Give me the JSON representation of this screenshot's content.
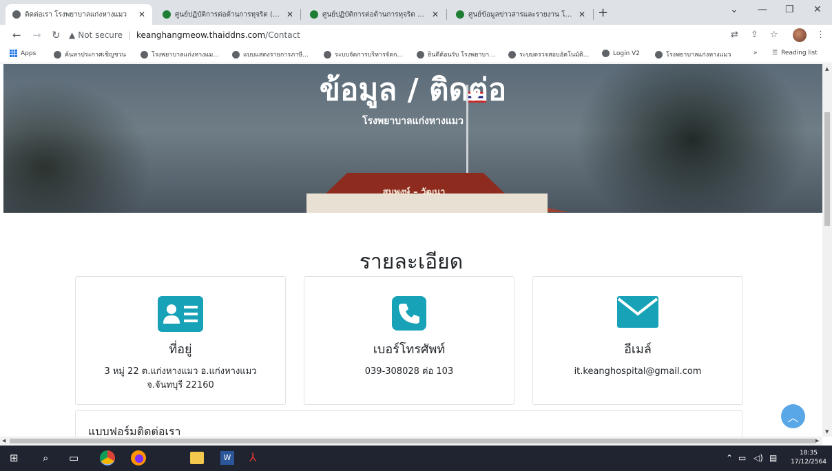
{
  "browser": {
    "tabs": [
      {
        "title": "ติดต่อเรา โรงพยาบาลแก่งหางแมว",
        "active": true,
        "icon": "globe-icon"
      },
      {
        "title": "ศูนย์ปฏิบัติการต่อต้านการทุจริต (สปท.)",
        "active": false,
        "icon": "shield-icon"
      },
      {
        "title": "ศูนย์ปฏิบัติการต่อต้านการทุจริต กระทร",
        "active": false,
        "icon": "shield-icon"
      },
      {
        "title": "ศูนย์ข้อมูลข่าวสารและรายงาน โรงพยา",
        "active": false,
        "icon": "shield-icon"
      }
    ],
    "new_tab": "+",
    "security_label": "Not secure",
    "url_host": "keanghangmeow.thaiddns.com",
    "url_path": "/Contact",
    "bookmarks": [
      "Apps",
      "ค้นหาประกาศเชิญชวน",
      "โรงพยาบาลแก่งหางแม...",
      "แบบแสดงรายการภาษี...",
      "ระบบจัดการบริหารจัดก...",
      "ยินดีต้อนรับ โรงพยาบา...",
      "ระบบตรวจสอบอัตโนมัติ...",
      "Login V2",
      "โรงพยาบาลแก่งหางแมว"
    ],
    "more_bookmarks": "»",
    "reading_list": "Reading list"
  },
  "hero": {
    "title": "ข้อมูล / ติดต่อ",
    "subtitle": "โรงพยาบาลแก่งหางแมว",
    "building_sign": "สมพงษ์ – วัฒนา"
  },
  "details": {
    "section_title": "รายละเอียด",
    "cards": [
      {
        "icon": "id-card-icon",
        "title": "ที่อยู่",
        "text": "3 หมู่ 22 ต.แก่งหางแมว อ.แก่งหางแมว จ.จันทบุรี 22160"
      },
      {
        "icon": "phone-icon",
        "title": "เบอร์โทรศัพท์",
        "text": "039-308028 ต่อ 103"
      },
      {
        "icon": "envelope-icon",
        "title": "อีเมล์",
        "text": "it.keanghospital@gmail.com"
      }
    ],
    "accent_color": "#17a2b8"
  },
  "contact_form": {
    "title": "แบบฟอร์มติดต่อเรา"
  },
  "taskbar": {
    "time": "18:35",
    "date": "17/12/2564"
  }
}
